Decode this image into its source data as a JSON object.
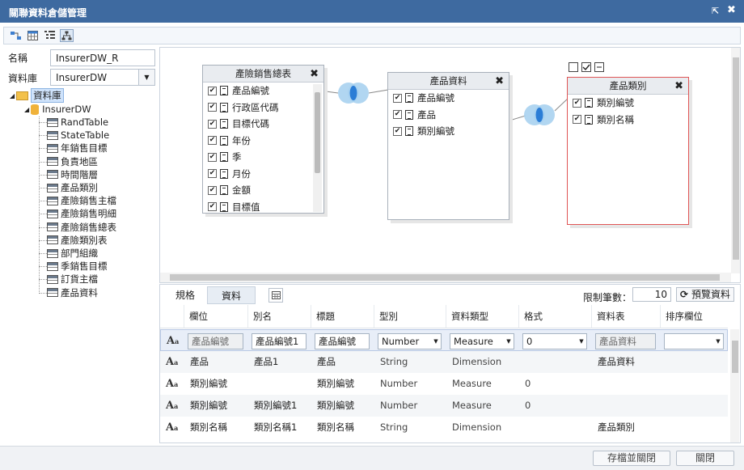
{
  "window": {
    "title": "關聯資料倉儲管理"
  },
  "left": {
    "name_label": "名稱",
    "name_value": "InsurerDW_R",
    "db_label": "資料庫",
    "db_value": "InsurerDW",
    "tree": {
      "root": "資料庫",
      "db": "InsurerDW",
      "tables": [
        "RandTable",
        "StateTable",
        "年銷售目標",
        "負責地區",
        "時間階層",
        "產品類別",
        "產險銷售主檔",
        "產險銷售明細",
        "產險銷售總表",
        "產險類別表",
        "部門組織",
        "季銷售目標",
        "訂貨主檔",
        "產品資料"
      ]
    }
  },
  "diagram": {
    "tables": [
      {
        "title": "產險銷售總表",
        "fields": [
          "產品編號",
          "行政區代碼",
          "目標代碼",
          "年份",
          "季",
          "月份",
          "金額",
          "目標值"
        ]
      },
      {
        "title": "產品資料",
        "fields": [
          "產品編號",
          "產品",
          "類別編號"
        ]
      },
      {
        "title": "產品類別",
        "fields": [
          "類別編號",
          "類別名稱"
        ]
      }
    ]
  },
  "bottom": {
    "tabs": [
      "規格",
      "資料"
    ],
    "limit_label": "限制筆數：",
    "limit_value": "10",
    "preview_label": "預覽資料",
    "columns": [
      "欄位",
      "別名",
      "標題",
      "型別",
      "資料類型",
      "格式",
      "資料表",
      "排序欄位"
    ],
    "rows": [
      {
        "field": "產品編號",
        "alias": "產品編號1",
        "caption": "產品編號",
        "type": "Number",
        "dtype": "Measure",
        "format": "0",
        "table": "產品資料",
        "sort": ""
      },
      {
        "field": "產品",
        "alias": "產品1",
        "caption": "產品",
        "type": "String",
        "dtype": "Dimension",
        "format": "",
        "table": "產品資料",
        "sort": ""
      },
      {
        "field": "類別編號",
        "alias": "",
        "caption": "類別編號",
        "type": "Number",
        "dtype": "Measure",
        "format": "0",
        "table": "",
        "sort": ""
      },
      {
        "field": "類別編號",
        "alias": "類別編號1",
        "caption": "類別編號",
        "type": "Number",
        "dtype": "Measure",
        "format": "0",
        "table": "",
        "sort": ""
      },
      {
        "field": "類別名稱",
        "alias": "類別名稱1",
        "caption": "類別名稱",
        "type": "String",
        "dtype": "Dimension",
        "format": "",
        "table": "產品類別",
        "sort": ""
      }
    ]
  },
  "footer": {
    "save_close": "存檔並關閉",
    "close": "關閉"
  }
}
